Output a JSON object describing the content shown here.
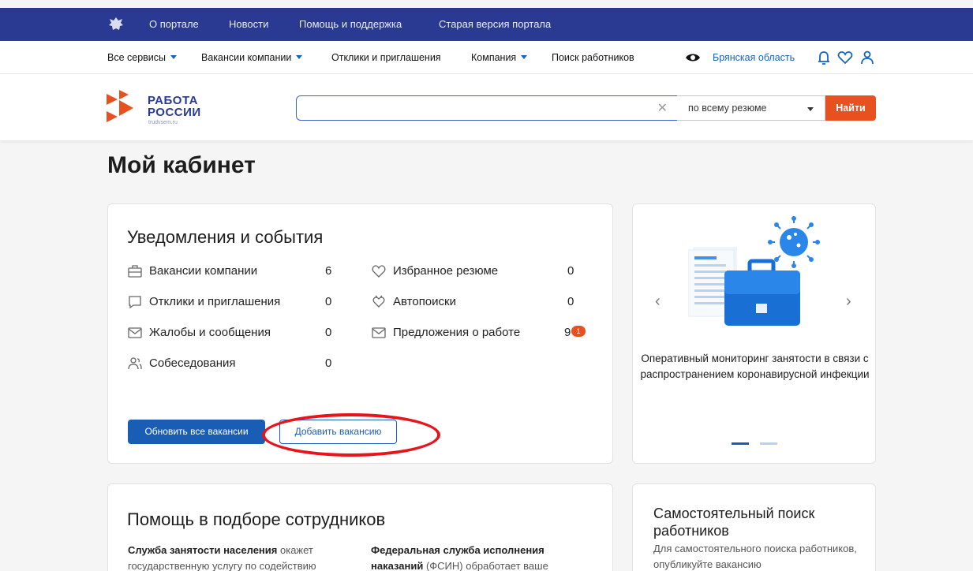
{
  "topbar": {
    "links": [
      "О портале",
      "Новости",
      "Помощь и поддержка",
      "Старая версия портала"
    ],
    "color": "#2a3a93"
  },
  "nav": {
    "items": [
      "Все сервисы",
      "Вакансии компании",
      "Отклики и приглашения",
      "Компания",
      "Поиск работников"
    ],
    "region": "Брянская область"
  },
  "logo": {
    "line1": "РАБОТА",
    "line2": "РОССИИ",
    "sub": "trudvsem.ru"
  },
  "search": {
    "value": "",
    "scope": "по всему резюме",
    "button": "Найти"
  },
  "page": {
    "title": "Мой кабинет"
  },
  "notifications": {
    "title": "Уведомления и события",
    "left": [
      {
        "label": "Вакансии компании",
        "count": "6",
        "icon": "briefcase-icon"
      },
      {
        "label": "Отклики и приглашения",
        "count": "0",
        "icon": "chat-icon"
      },
      {
        "label": "Жалобы и сообщения",
        "count": "0",
        "icon": "mail-icon"
      },
      {
        "label": "Собеседования",
        "count": "0",
        "icon": "people-icon"
      }
    ],
    "right": [
      {
        "label": "Избранное резюме",
        "count": "0",
        "icon": "heart-icon"
      },
      {
        "label": "Автопоиски",
        "count": "0",
        "icon": "heart-search-icon"
      },
      {
        "label": "Предложения о работе",
        "count": "9",
        "badge": "1",
        "icon": "mail-icon"
      }
    ],
    "btn_update": "Обновить все вакансии",
    "btn_add": "Добавить вакансию"
  },
  "promo": {
    "text": "Оперативный мониторинг занятости в связи с распространением коронавирусной инфекции",
    "slides": 2,
    "active_slide": 1
  },
  "help": {
    "title": "Помощь в подборе сотрудников",
    "col1_bold": "Служба занятости населения",
    "col1_text": " окажет государственную услугу по содействию",
    "col2_bold": "Федеральная служба исполнения наказаний",
    "col2_text": " (ФСИН) обработает ваше"
  },
  "self_search": {
    "title": "Самостоятельный поиск работников",
    "text": "Для самостоятельного поиска работников, опубликуйте вакансию"
  },
  "colors": {
    "accent": "#1a5db5",
    "orange": "#e8501f",
    "annotation": "#e8131b"
  }
}
